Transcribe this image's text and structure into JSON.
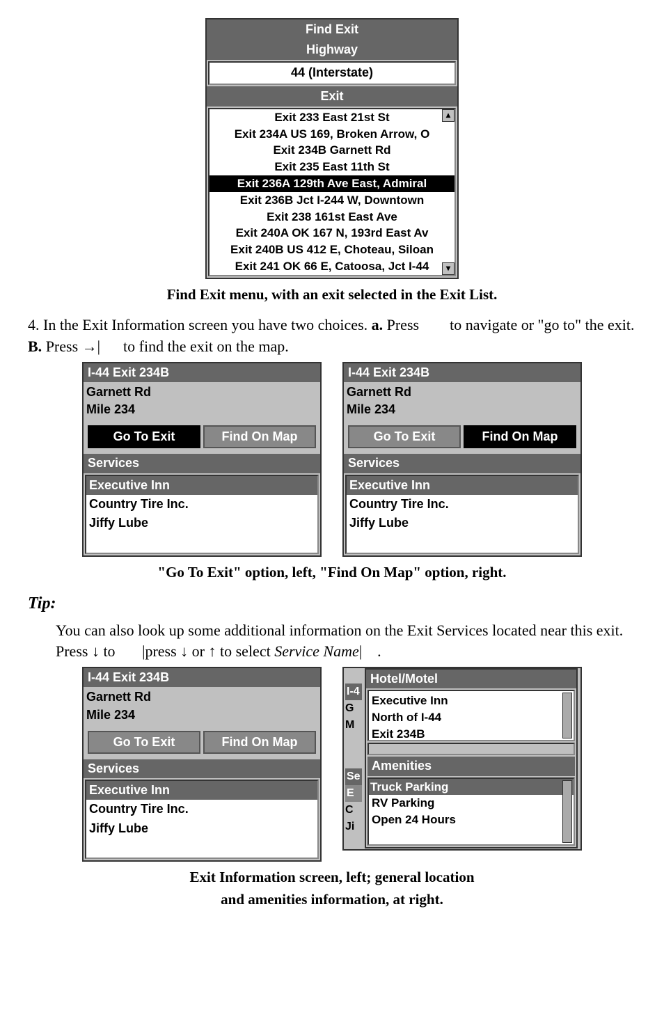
{
  "fig1": {
    "title": "Find Exit",
    "highway_label": "Highway",
    "highway_value": "44 (Interstate)",
    "exit_label": "Exit",
    "exits": [
      "Exit 233 East 21st St",
      "Exit 234A US 169, Broken Arrow, O",
      "Exit 234B Garnett Rd",
      "Exit 235 East 11th St",
      "Exit 236A 129th Ave East, Admiral",
      "Exit 236B Jct I-244 W, Downtown",
      "Exit 238 161st East Ave",
      "Exit 240A OK 167 N, 193rd East Av",
      "Exit 240B US 412 E, Choteau, Siloan",
      "Exit 241 OK 66 E, Catoosa, Jct I-44"
    ],
    "selected_index": 4,
    "caption": "Find Exit menu, with an exit selected in the Exit List."
  },
  "step4_text_a": "4. In the Exit Information screen you have two choices. ",
  "step4_bold_a": "a.",
  "step4_text_b": " Press ",
  "step4_text_c": " to navigate or \"go to\" the exit. ",
  "step4_bold_b": "B.",
  "step4_text_d": " Press →| ",
  "step4_text_e": " to find the exit on the map.",
  "info_screen": {
    "header": "I-44 Exit 234B",
    "line1": "Garnett Rd",
    "line2": "Mile 234",
    "btn_go": "Go To Exit",
    "btn_find": "Find On Map",
    "services_label": "Services",
    "services": [
      "Executive Inn",
      "Country Tire Inc.",
      "Jiffy Lube"
    ]
  },
  "fig2_caption": "\"Go To Exit\" option, left, \"Find On Map\" option, right.",
  "tip_label": "Tip:",
  "tip_text_a": "You can also look up some additional information on the Exit Services located near this exit. Press ↓ to ",
  "tip_text_b": "|press ↓ or ↑ to select ",
  "tip_text_c": "Service Name",
  "tip_text_d": "| ",
  "tip_text_e": " .",
  "popup": {
    "header": "Hotel/Motel",
    "line1": "Executive Inn",
    "line2": "North of I-44",
    "line3": "Exit 234B",
    "amen_label": "Amenities",
    "amenities": [
      "Truck Parking",
      "RV Parking",
      "Open 24 Hours"
    ],
    "bg_letters_top": [
      "I-4",
      "G",
      "M"
    ],
    "bg_letters_bot": [
      "Se",
      "E",
      "C",
      "Ji"
    ]
  },
  "fig3_caption1": "Exit Information screen, left; general location",
  "fig3_caption2": "and amenities information, at right."
}
